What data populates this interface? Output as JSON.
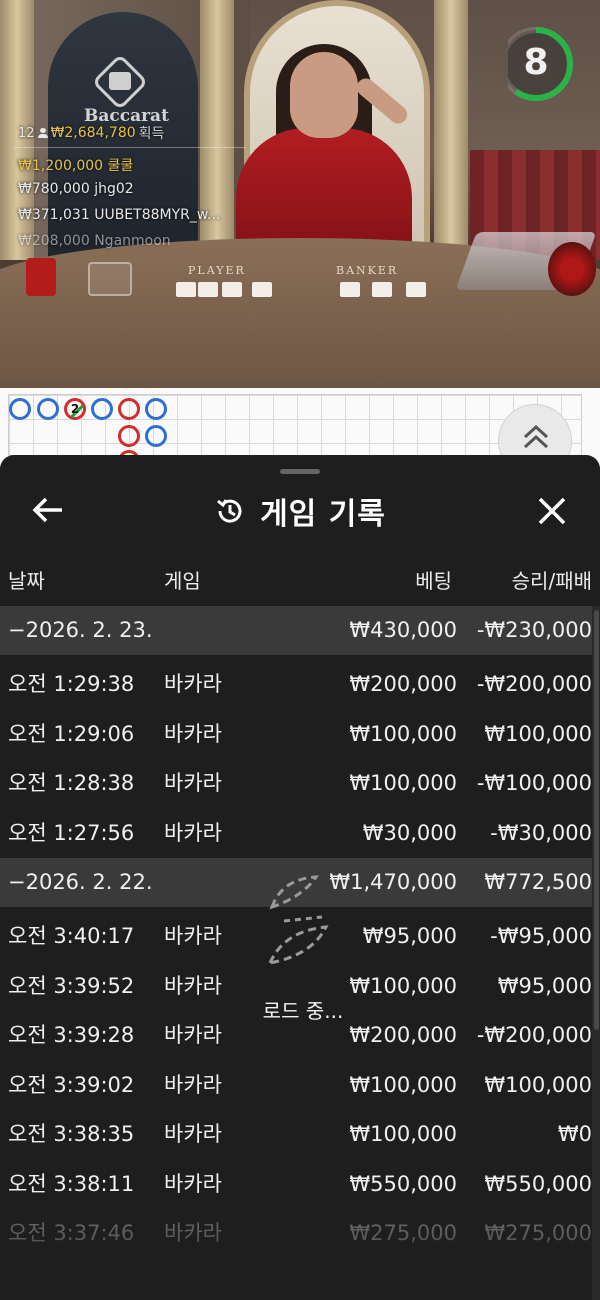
{
  "video": {
    "logo_text": "Baccarat",
    "timer_value": "8",
    "timer_fraction": 0.6,
    "overlay": {
      "player_count": "12",
      "total_winnings": "₩2,684,780",
      "winnings_label": "획득",
      "top_winners": [
        {
          "amount": "₩1,200,000",
          "name": "쿨쿨",
          "highlight": true
        },
        {
          "amount": "₩780,000",
          "name": "jhg02",
          "highlight": false
        },
        {
          "amount": "₩371,031",
          "name": "UUBET88MYR_w...",
          "highlight": false
        },
        {
          "amount": "₩208,000",
          "name": "Nganmoon",
          "highlight": false
        }
      ]
    },
    "table_labels": {
      "player": "PLAYER",
      "banker": "BANKER"
    }
  },
  "scoreboard": {
    "bead_number": "2"
  },
  "sheet": {
    "title": "게임 기록",
    "columns": {
      "date": "날짜",
      "game": "게임",
      "bet": "베팅",
      "result": "승리/패배"
    },
    "loading_text": "로드 중...",
    "rows": [
      {
        "type": "group",
        "date": "−2026. 2. 23.",
        "game": "",
        "bet": "₩430,000",
        "result": "-₩230,000"
      },
      {
        "type": "item",
        "date": "오전 1:29:38",
        "game": "바카라",
        "bet": "₩200,000",
        "result": "-₩200,000"
      },
      {
        "type": "item",
        "date": "오전 1:29:06",
        "game": "바카라",
        "bet": "₩100,000",
        "result": "₩100,000"
      },
      {
        "type": "item",
        "date": "오전 1:28:38",
        "game": "바카라",
        "bet": "₩100,000",
        "result": "-₩100,000"
      },
      {
        "type": "item",
        "date": "오전 1:27:56",
        "game": "바카라",
        "bet": "₩30,000",
        "result": "-₩30,000"
      },
      {
        "type": "group",
        "date": "−2026. 2. 22.",
        "game": "",
        "bet": "₩1,470,000",
        "result": "₩772,500"
      },
      {
        "type": "item",
        "date": "오전 3:40:17",
        "game": "바카라",
        "bet": "₩95,000",
        "result": "-₩95,000"
      },
      {
        "type": "item",
        "date": "오전 3:39:52",
        "game": "바카라",
        "bet": "₩100,000",
        "result": "₩95,000"
      },
      {
        "type": "item",
        "date": "오전 3:39:28",
        "game": "바카라",
        "bet": "₩200,000",
        "result": "-₩200,000"
      },
      {
        "type": "item",
        "date": "오전 3:39:02",
        "game": "바카라",
        "bet": "₩100,000",
        "result": "₩100,000"
      },
      {
        "type": "item",
        "date": "오전 3:38:35",
        "game": "바카라",
        "bet": "₩100,000",
        "result": "₩0"
      },
      {
        "type": "item",
        "date": "오전 3:38:11",
        "game": "바카라",
        "bet": "₩550,000",
        "result": "₩550,000"
      },
      {
        "type": "item",
        "date": "오전 3:37:46",
        "game": "바카라",
        "bet": "₩275,000",
        "result": "₩275,000",
        "faded": true
      }
    ]
  }
}
